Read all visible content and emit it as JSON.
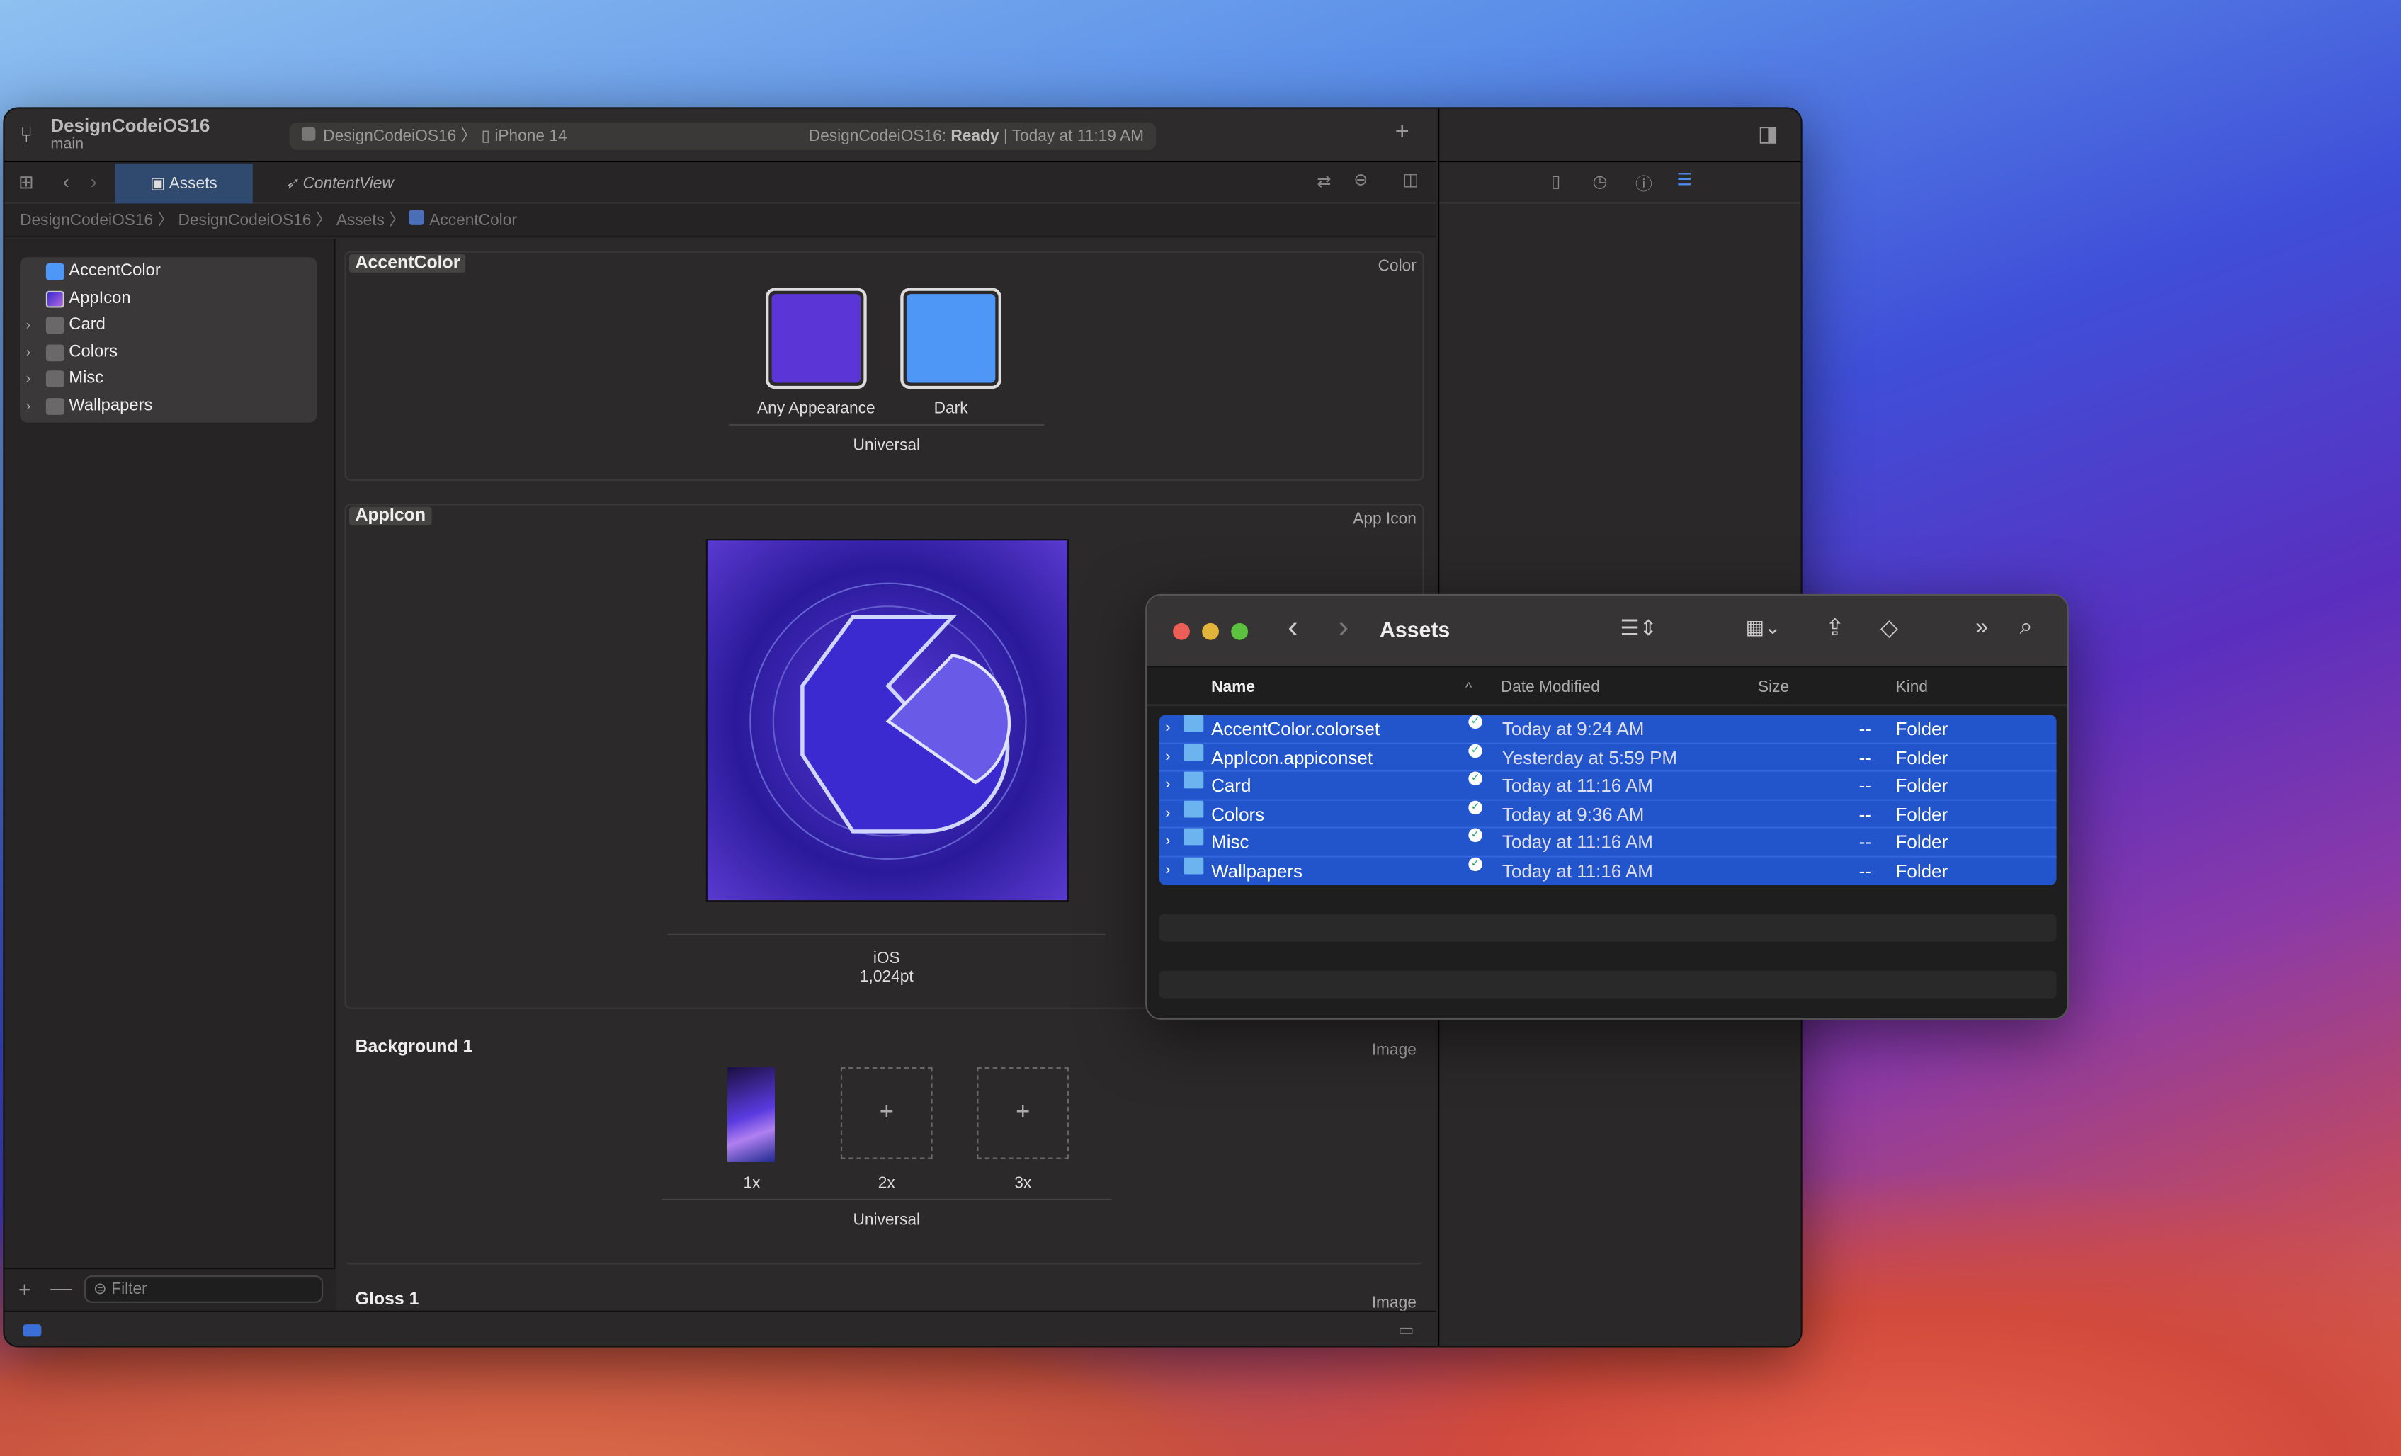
{
  "xcode": {
    "project": "DesignCodeiOS16",
    "branch": "main",
    "scheme": {
      "target": "DesignCodeiOS16",
      "device": "iPhone 14",
      "status_prefix": "DesignCodeiOS16: ",
      "status_bold": "Ready",
      "status_suffix": " | Today at 11:19 AM"
    },
    "tabs": [
      {
        "label": "Assets",
        "active": true
      },
      {
        "label": "ContentView",
        "active": false
      }
    ],
    "breadcrumbs": [
      "DesignCodeiOS16",
      "DesignCodeiOS16",
      "Assets",
      "AccentColor"
    ],
    "navigator": [
      {
        "label": "AccentColor",
        "icon": "color-swatch-icon",
        "expandable": false,
        "selected": true
      },
      {
        "label": "AppIcon",
        "icon": "app-icon-icon",
        "expandable": false
      },
      {
        "label": "Card",
        "icon": "folder-icon",
        "expandable": true
      },
      {
        "label": "Colors",
        "icon": "folder-icon",
        "expandable": true
      },
      {
        "label": "Misc",
        "icon": "folder-icon",
        "expandable": true
      },
      {
        "label": "Wallpapers",
        "icon": "folder-icon",
        "expandable": true
      }
    ],
    "filter_placeholder": "Filter",
    "editor": {
      "accent": {
        "title": "AccentColor",
        "type": "Color",
        "any_label": "Any Appearance",
        "dark_label": "Dark",
        "group": "Universal",
        "any_color": "#5b35d5",
        "dark_color": "#4f97f7"
      },
      "appicon": {
        "title": "AppIcon",
        "type": "App Icon",
        "platform": "iOS",
        "size": "1,024pt"
      },
      "background": {
        "title": "Background 1",
        "type": "Image",
        "slots": [
          "1x",
          "2x",
          "3x"
        ],
        "group": "Universal"
      },
      "gloss": {
        "title": "Gloss 1",
        "type": "Image"
      }
    }
  },
  "finder": {
    "title": "Assets",
    "columns": [
      "Name",
      "Date Modified",
      "Size",
      "Kind"
    ],
    "rows": [
      {
        "name": "AccentColor.colorset",
        "date": "Today at 9:24 AM",
        "size": "--",
        "kind": "Folder"
      },
      {
        "name": "AppIcon.appiconset",
        "date": "Yesterday at 5:59 PM",
        "size": "--",
        "kind": "Folder"
      },
      {
        "name": "Card",
        "date": "Today at 11:16 AM",
        "size": "--",
        "kind": "Folder"
      },
      {
        "name": "Colors",
        "date": "Today at 9:36 AM",
        "size": "--",
        "kind": "Folder"
      },
      {
        "name": "Misc",
        "date": "Today at 11:16 AM",
        "size": "--",
        "kind": "Folder"
      },
      {
        "name": "Wallpapers",
        "date": "Today at 11:16 AM",
        "size": "--",
        "kind": "Folder"
      }
    ],
    "selection_color": "#2255cc"
  }
}
